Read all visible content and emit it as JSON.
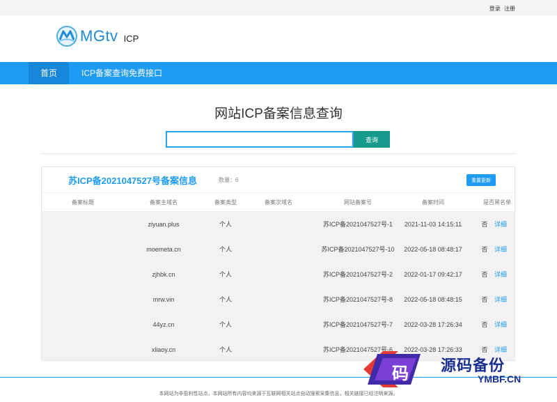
{
  "topbar": {
    "login": "登录",
    "register": "注册"
  },
  "header": {
    "logo_text": "MGtv",
    "logo_sub": "ICP"
  },
  "nav": {
    "home": "首页",
    "api": "ICP备案查询免费接口"
  },
  "page": {
    "title": "网站ICP备案信息查询"
  },
  "search": {
    "value": "",
    "placeholder": "",
    "button": "查询"
  },
  "panel": {
    "title": "苏ICP备2021047527号备案信息",
    "count": "数量：6",
    "refresh": "重置更新",
    "headers": [
      "备案标题",
      "备案主域名",
      "备案类型",
      "备案次域名",
      "网站备案号",
      "备案时间",
      "是否黑名单"
    ],
    "rows": [
      {
        "title": "",
        "domain": "ziyuan.plus",
        "type": "个人",
        "sub": "",
        "icp": "苏ICP备2021047527号-1",
        "time": "2021-11-03 14:15:11",
        "blacklist": "否",
        "detail": "详细"
      },
      {
        "title": "",
        "domain": "moemeta.cn",
        "type": "个人",
        "sub": "",
        "icp": "苏ICP备2021047527号-10",
        "time": "2022-05-18 08:48:17",
        "blacklist": "否",
        "detail": "详细"
      },
      {
        "title": "",
        "domain": "zjhbk.cn",
        "type": "个人",
        "sub": "",
        "icp": "苏ICP备2021047527号-2",
        "time": "2022-01-17 09:42:17",
        "blacklist": "否",
        "detail": "详细"
      },
      {
        "title": "",
        "domain": "mrw.vin",
        "type": "个人",
        "sub": "",
        "icp": "苏ICP备2021047527号-8",
        "time": "2022-05-18 08:48:15",
        "blacklist": "否",
        "detail": "详细"
      },
      {
        "title": "",
        "domain": "44yz.cn",
        "type": "个人",
        "sub": "",
        "icp": "苏ICP备2021047527号-7",
        "time": "2022-03-28 17:26:34",
        "blacklist": "否",
        "detail": "详细"
      },
      {
        "title": "",
        "domain": "xliaoy.cn",
        "type": "个人",
        "sub": "",
        "icp": "苏ICP备2021047527号-6",
        "time": "2022-03-28 17:26:33",
        "blacklist": "否",
        "detail": "详细"
      }
    ]
  },
  "footer": {
    "text": "本网站为非盈利性站点，本网站所有内容均来源于互联网相关站点自动搜索采集信息，相关链接已经注明来源。"
  },
  "watermark": {
    "char": "码",
    "cn": "源码备份",
    "en": "YMBF.CN"
  },
  "colors": {
    "brand": "#1e9bf2",
    "search_button": "#159a8c",
    "watermark": "#1a2f8f"
  },
  "icons": {
    "logo": "mgtv-logo-icon",
    "watermark": "ymbf-logo-icon"
  }
}
